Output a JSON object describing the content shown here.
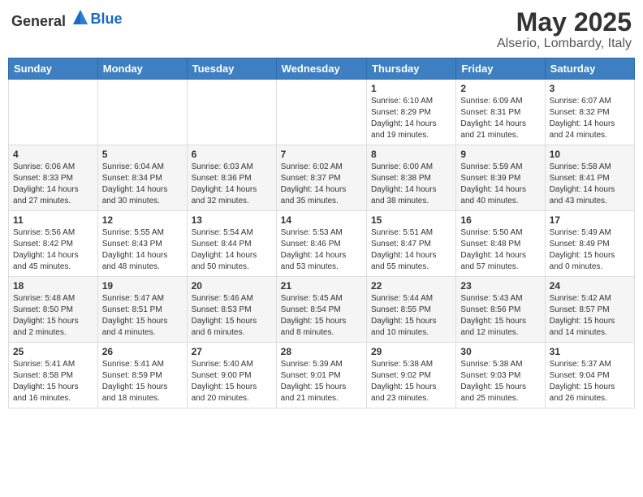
{
  "header": {
    "logo_general": "General",
    "logo_blue": "Blue",
    "month": "May 2025",
    "location": "Alserio, Lombardy, Italy"
  },
  "weekdays": [
    "Sunday",
    "Monday",
    "Tuesday",
    "Wednesday",
    "Thursday",
    "Friday",
    "Saturday"
  ],
  "weeks": [
    [
      {
        "day": "",
        "info": ""
      },
      {
        "day": "",
        "info": ""
      },
      {
        "day": "",
        "info": ""
      },
      {
        "day": "",
        "info": ""
      },
      {
        "day": "1",
        "info": "Sunrise: 6:10 AM\nSunset: 8:29 PM\nDaylight: 14 hours\nand 19 minutes."
      },
      {
        "day": "2",
        "info": "Sunrise: 6:09 AM\nSunset: 8:31 PM\nDaylight: 14 hours\nand 21 minutes."
      },
      {
        "day": "3",
        "info": "Sunrise: 6:07 AM\nSunset: 8:32 PM\nDaylight: 14 hours\nand 24 minutes."
      }
    ],
    [
      {
        "day": "4",
        "info": "Sunrise: 6:06 AM\nSunset: 8:33 PM\nDaylight: 14 hours\nand 27 minutes."
      },
      {
        "day": "5",
        "info": "Sunrise: 6:04 AM\nSunset: 8:34 PM\nDaylight: 14 hours\nand 30 minutes."
      },
      {
        "day": "6",
        "info": "Sunrise: 6:03 AM\nSunset: 8:36 PM\nDaylight: 14 hours\nand 32 minutes."
      },
      {
        "day": "7",
        "info": "Sunrise: 6:02 AM\nSunset: 8:37 PM\nDaylight: 14 hours\nand 35 minutes."
      },
      {
        "day": "8",
        "info": "Sunrise: 6:00 AM\nSunset: 8:38 PM\nDaylight: 14 hours\nand 38 minutes."
      },
      {
        "day": "9",
        "info": "Sunrise: 5:59 AM\nSunset: 8:39 PM\nDaylight: 14 hours\nand 40 minutes."
      },
      {
        "day": "10",
        "info": "Sunrise: 5:58 AM\nSunset: 8:41 PM\nDaylight: 14 hours\nand 43 minutes."
      }
    ],
    [
      {
        "day": "11",
        "info": "Sunrise: 5:56 AM\nSunset: 8:42 PM\nDaylight: 14 hours\nand 45 minutes."
      },
      {
        "day": "12",
        "info": "Sunrise: 5:55 AM\nSunset: 8:43 PM\nDaylight: 14 hours\nand 48 minutes."
      },
      {
        "day": "13",
        "info": "Sunrise: 5:54 AM\nSunset: 8:44 PM\nDaylight: 14 hours\nand 50 minutes."
      },
      {
        "day": "14",
        "info": "Sunrise: 5:53 AM\nSunset: 8:46 PM\nDaylight: 14 hours\nand 53 minutes."
      },
      {
        "day": "15",
        "info": "Sunrise: 5:51 AM\nSunset: 8:47 PM\nDaylight: 14 hours\nand 55 minutes."
      },
      {
        "day": "16",
        "info": "Sunrise: 5:50 AM\nSunset: 8:48 PM\nDaylight: 14 hours\nand 57 minutes."
      },
      {
        "day": "17",
        "info": "Sunrise: 5:49 AM\nSunset: 8:49 PM\nDaylight: 15 hours\nand 0 minutes."
      }
    ],
    [
      {
        "day": "18",
        "info": "Sunrise: 5:48 AM\nSunset: 8:50 PM\nDaylight: 15 hours\nand 2 minutes."
      },
      {
        "day": "19",
        "info": "Sunrise: 5:47 AM\nSunset: 8:51 PM\nDaylight: 15 hours\nand 4 minutes."
      },
      {
        "day": "20",
        "info": "Sunrise: 5:46 AM\nSunset: 8:53 PM\nDaylight: 15 hours\nand 6 minutes."
      },
      {
        "day": "21",
        "info": "Sunrise: 5:45 AM\nSunset: 8:54 PM\nDaylight: 15 hours\nand 8 minutes."
      },
      {
        "day": "22",
        "info": "Sunrise: 5:44 AM\nSunset: 8:55 PM\nDaylight: 15 hours\nand 10 minutes."
      },
      {
        "day": "23",
        "info": "Sunrise: 5:43 AM\nSunset: 8:56 PM\nDaylight: 15 hours\nand 12 minutes."
      },
      {
        "day": "24",
        "info": "Sunrise: 5:42 AM\nSunset: 8:57 PM\nDaylight: 15 hours\nand 14 minutes."
      }
    ],
    [
      {
        "day": "25",
        "info": "Sunrise: 5:41 AM\nSunset: 8:58 PM\nDaylight: 15 hours\nand 16 minutes."
      },
      {
        "day": "26",
        "info": "Sunrise: 5:41 AM\nSunset: 8:59 PM\nDaylight: 15 hours\nand 18 minutes."
      },
      {
        "day": "27",
        "info": "Sunrise: 5:40 AM\nSunset: 9:00 PM\nDaylight: 15 hours\nand 20 minutes."
      },
      {
        "day": "28",
        "info": "Sunrise: 5:39 AM\nSunset: 9:01 PM\nDaylight: 15 hours\nand 21 minutes."
      },
      {
        "day": "29",
        "info": "Sunrise: 5:38 AM\nSunset: 9:02 PM\nDaylight: 15 hours\nand 23 minutes."
      },
      {
        "day": "30",
        "info": "Sunrise: 5:38 AM\nSunset: 9:03 PM\nDaylight: 15 hours\nand 25 minutes."
      },
      {
        "day": "31",
        "info": "Sunrise: 5:37 AM\nSunset: 9:04 PM\nDaylight: 15 hours\nand 26 minutes."
      }
    ]
  ]
}
